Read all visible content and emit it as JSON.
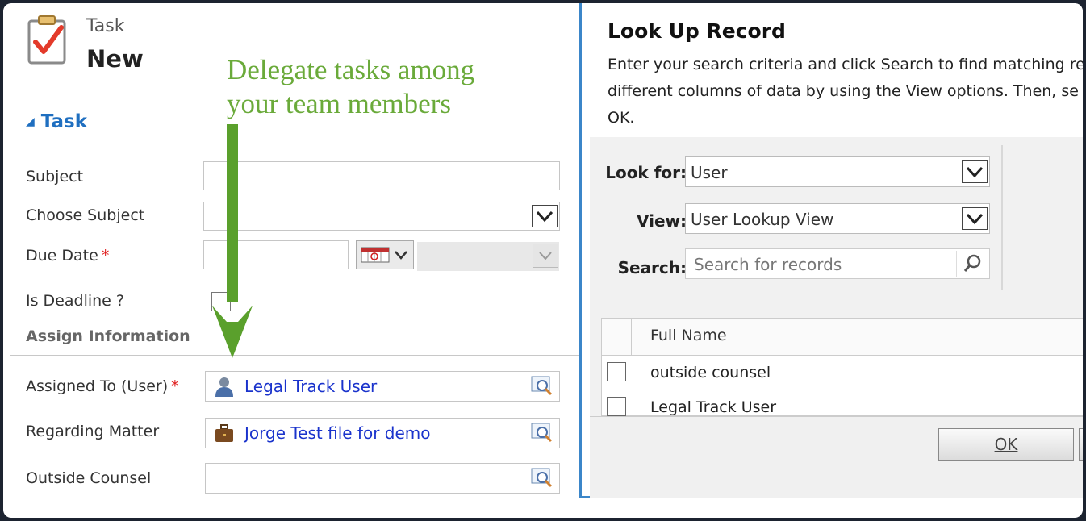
{
  "header": {
    "entity_type": "Task",
    "entity_name": "New"
  },
  "annotation": {
    "line1": "Delegate tasks among",
    "line2": "your team members"
  },
  "section": {
    "title": "Task"
  },
  "fields": {
    "subject": "Subject",
    "choose_subject": "Choose Subject",
    "due_date": "Due Date",
    "is_deadline": "Is Deadline ?",
    "assign_info": "Assign Information",
    "assigned_to": "Assigned To (User)",
    "assigned_to_value": "Legal Track User",
    "regarding_matter": "Regarding Matter",
    "regarding_matter_value": "Jorge Test file for demo",
    "outside_counsel": "Outside Counsel",
    "required_mark": "*"
  },
  "dialog": {
    "title": "Look Up Record",
    "desc_line1": "Enter your search criteria and click Search to find matching re",
    "desc_line2": "different columns of data by using the View options. Then, se",
    "desc_line3": "OK.",
    "look_for_label": "Look for:",
    "look_for_value": "User",
    "view_label": "View:",
    "view_value": "User Lookup View",
    "search_label": "Search:",
    "search_placeholder": "Search for records",
    "grid_header": "Full Name",
    "rows": [
      "outside counsel",
      "Legal Track User"
    ],
    "ok_label": "OK"
  },
  "colors": {
    "accent_blue": "#1f6fc0",
    "link_blue": "#1a33cc",
    "annotation_green": "#6aaa3a",
    "required_red": "#e02020",
    "dialog_border": "#3b86c9"
  }
}
